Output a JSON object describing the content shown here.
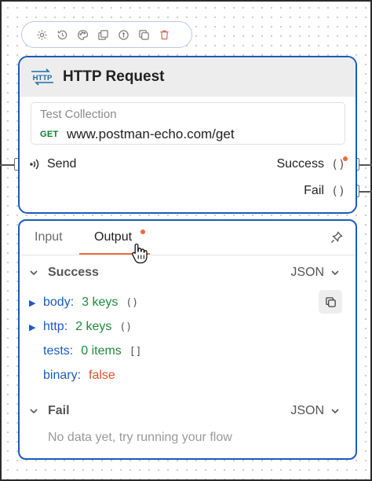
{
  "toolbar": {
    "icons": [
      "settings-icon",
      "clock-history-icon",
      "palette-icon",
      "duplicate-icon",
      "info-icon",
      "copy-icon",
      "delete-icon"
    ]
  },
  "node": {
    "logo_text": "HTTP",
    "title": "HTTP Request",
    "collection": "Test Collection",
    "method": "GET",
    "url": "www.postman-echo.com/get",
    "input_label": "Send",
    "outputs": [
      {
        "label": "Success",
        "indicator": "()"
      },
      {
        "label": "Fail",
        "indicator": "()"
      }
    ]
  },
  "panel": {
    "tabs": [
      {
        "label": "Input",
        "active": false
      },
      {
        "label": "Output",
        "active": true
      }
    ],
    "success": {
      "title": "Success",
      "format": "JSON",
      "rows": [
        {
          "key": "body:",
          "value": "3 keys",
          "bracket": "()"
        },
        {
          "key": "http:",
          "value": "2 keys",
          "bracket": "()"
        },
        {
          "key": "tests:",
          "value": "0 items",
          "bracket": "[]"
        },
        {
          "key": "binary:",
          "value": "false"
        }
      ]
    },
    "fail": {
      "title": "Fail",
      "format": "JSON",
      "empty_message": "No data yet, try running your flow"
    }
  },
  "colors": {
    "accent_blue": "#1a5bbf",
    "indicator_orange": "#f26b3a",
    "value_green": "#1e8a3a",
    "value_red": "#e0512b"
  }
}
